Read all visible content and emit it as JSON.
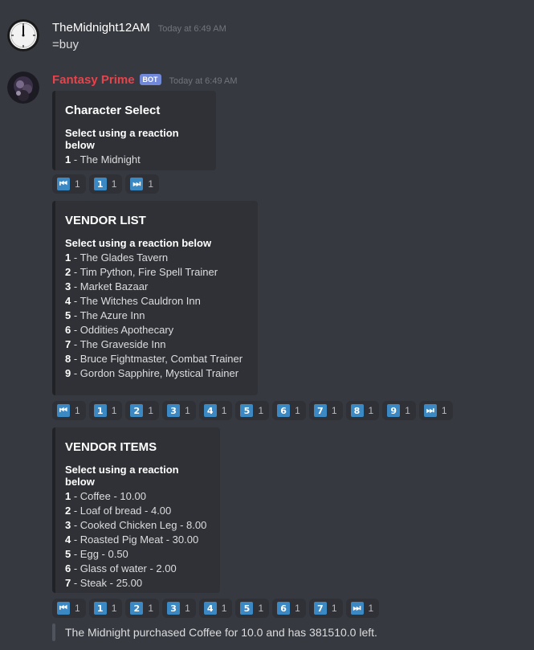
{
  "messages": [
    {
      "author": "TheMidnight12AM",
      "timestamp": "Today at 6:49 AM",
      "content": "=buy",
      "avatar_icon": "clock-icon"
    },
    {
      "author": "Fantasy Prime",
      "bot_tag": "BOT",
      "timestamp": "Today at 6:49 AM",
      "avatar_icon": "bot-avatar-icon",
      "author_color": "#e8424b"
    }
  ],
  "embeds": [
    {
      "title": "Character Select",
      "subtitle": "Select using a reaction below",
      "items": [
        {
          "num": "1",
          "text": "The Midnight"
        }
      ]
    },
    {
      "title": "VENDOR LIST",
      "subtitle": "Select using a reaction below",
      "items": [
        {
          "num": "1",
          "text": "The Glades Tavern"
        },
        {
          "num": "2",
          "text": "Tim Python, Fire Spell Trainer"
        },
        {
          "num": "3",
          "text": "Market Bazaar"
        },
        {
          "num": "4",
          "text": "The Witches Cauldron Inn"
        },
        {
          "num": "5",
          "text": "The Azure Inn"
        },
        {
          "num": "6",
          "text": "Oddities Apothecary"
        },
        {
          "num": "7",
          "text": "The Graveside Inn"
        },
        {
          "num": "8",
          "text": "Bruce Fightmaster, Combat Trainer"
        },
        {
          "num": "9",
          "text": "Gordon Sapphire, Mystical Trainer"
        }
      ]
    },
    {
      "title": "VENDOR ITEMS",
      "subtitle": "Select using a reaction below",
      "items": [
        {
          "num": "1",
          "text": "Coffee - 10.00"
        },
        {
          "num": "2",
          "text": "Loaf of bread - 4.00"
        },
        {
          "num": "3",
          "text": "Cooked Chicken Leg - 8.00"
        },
        {
          "num": "4",
          "text": "Roasted Pig Meat - 30.00"
        },
        {
          "num": "5",
          "text": "Egg - 0.50"
        },
        {
          "num": "6",
          "text": "Glass of water - 2.00"
        },
        {
          "num": "7",
          "text": "Steak - 25.00"
        }
      ]
    }
  ],
  "reaction_rows": [
    [
      {
        "glyph": "⏮",
        "icon": "track-previous-icon",
        "count": "1"
      },
      {
        "glyph": "1",
        "icon": "keycap-1-icon",
        "count": "1"
      },
      {
        "glyph": "⏭",
        "icon": "track-next-icon",
        "count": "1"
      }
    ],
    [
      {
        "glyph": "⏮",
        "icon": "track-previous-icon",
        "count": "1"
      },
      {
        "glyph": "1",
        "icon": "keycap-1-icon",
        "count": "1"
      },
      {
        "glyph": "2",
        "icon": "keycap-2-icon",
        "count": "1"
      },
      {
        "glyph": "3",
        "icon": "keycap-3-icon",
        "count": "1"
      },
      {
        "glyph": "4",
        "icon": "keycap-4-icon",
        "count": "1"
      },
      {
        "glyph": "5",
        "icon": "keycap-5-icon",
        "count": "1"
      },
      {
        "glyph": "6",
        "icon": "keycap-6-icon",
        "count": "1"
      },
      {
        "glyph": "7",
        "icon": "keycap-7-icon",
        "count": "1"
      },
      {
        "glyph": "8",
        "icon": "keycap-8-icon",
        "count": "1"
      },
      {
        "glyph": "9",
        "icon": "keycap-9-icon",
        "count": "1"
      },
      {
        "glyph": "⏭",
        "icon": "track-next-icon",
        "count": "1"
      }
    ],
    [
      {
        "glyph": "⏮",
        "icon": "track-previous-icon",
        "count": "1"
      },
      {
        "glyph": "1",
        "icon": "keycap-1-icon",
        "count": "1"
      },
      {
        "glyph": "2",
        "icon": "keycap-2-icon",
        "count": "1"
      },
      {
        "glyph": "3",
        "icon": "keycap-3-icon",
        "count": "1"
      },
      {
        "glyph": "4",
        "icon": "keycap-4-icon",
        "count": "1"
      },
      {
        "glyph": "5",
        "icon": "keycap-5-icon",
        "count": "1"
      },
      {
        "glyph": "6",
        "icon": "keycap-6-icon",
        "count": "1"
      },
      {
        "glyph": "7",
        "icon": "keycap-7-icon",
        "count": "1"
      },
      {
        "glyph": "⏭",
        "icon": "track-next-icon",
        "count": "1"
      }
    ]
  ],
  "result_quote": "The Midnight purchased Coffee for 10.0 and has 381510.0 left.",
  "colors": {
    "background": "#36393f",
    "embed_bg": "#2f3136",
    "keycap_blue": "#3b88c3",
    "bot_tag": "#7289da"
  }
}
